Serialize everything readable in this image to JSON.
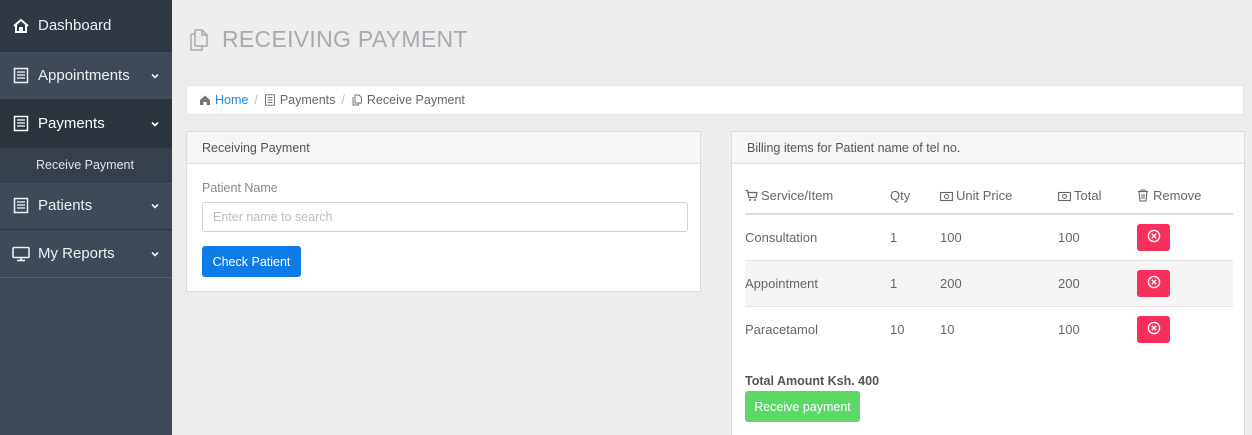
{
  "sidebar": {
    "items": [
      {
        "label": "Dashboard",
        "icon": "home-icon"
      },
      {
        "label": "Appointments",
        "icon": "document-icon"
      },
      {
        "label": "Payments",
        "icon": "document-icon"
      },
      {
        "label": "Patients",
        "icon": "document-icon"
      },
      {
        "label": "My Reports",
        "icon": "monitor-icon"
      }
    ],
    "subitem": "Receive Payment"
  },
  "header": {
    "title": "RECEIVING PAYMENT",
    "icon": "copy-icon"
  },
  "breadcrumb": {
    "home": "Home",
    "sep": "/",
    "payments": "Payments",
    "current": "Receive Payment"
  },
  "left_panel": {
    "title": "Receiving Payment",
    "field_label": "Patient Name",
    "placeholder": "Enter name to search",
    "button": "Check Patient"
  },
  "right_panel": {
    "title": "Billing items for Patient name of tel no.",
    "columns": [
      "Service/Item",
      "Qty",
      "Unit Price",
      "Total",
      "Remove"
    ],
    "rows": [
      {
        "item": "Consultation",
        "qty": "1",
        "price": "100",
        "total": "100"
      },
      {
        "item": "Appointment",
        "qty": "1",
        "price": "200",
        "total": "200"
      },
      {
        "item": "Paracetamol",
        "qty": "10",
        "price": "10",
        "total": "100"
      }
    ],
    "total_text": "Total Amount Ksh. 400",
    "button": "Receive payment"
  },
  "colors": {
    "primary": "#0d7be8",
    "danger": "#f72f5a",
    "success": "#5cd867",
    "sidebar": "#3f4a58"
  }
}
